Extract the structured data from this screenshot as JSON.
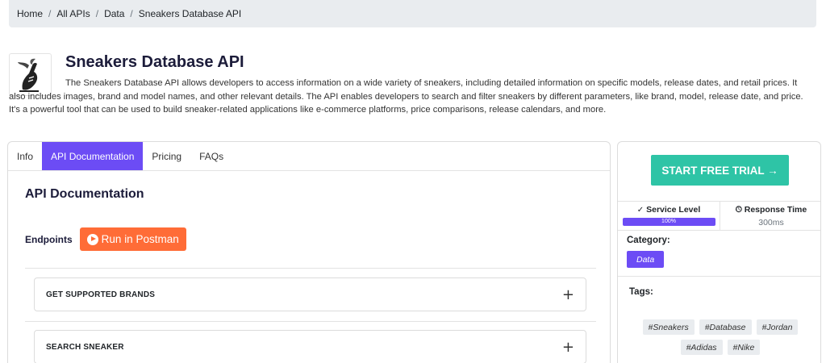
{
  "breadcrumb": [
    "Home",
    "All APIs",
    "Data",
    "Sneakers Database API"
  ],
  "api": {
    "title": "Sneakers Database API",
    "description": "The Sneakers Database API allows developers to access information on a wide variety of sneakers, including detailed information on specific models, release dates, and retail prices. It also includes images, brand and model names, and other relevant details. The API enables developers to search and filter sneakers by different parameters, like brand, model, release date, and price. It's a powerful tool that can be used to build sneaker-related applications like e-commerce platforms, price comparisons, release calendars, and more."
  },
  "tabs": [
    {
      "label": "Info",
      "active": false
    },
    {
      "label": "API Documentation",
      "active": true
    },
    {
      "label": "Pricing",
      "active": false
    },
    {
      "label": "FAQs",
      "active": false
    }
  ],
  "documentation": {
    "title": "API Documentation",
    "endpoints_label": "Endpoints",
    "postman_label": "Run in Postman",
    "endpoints": [
      {
        "name": "GET SUPPORTED BRANDS",
        "icon": "plus-icon"
      },
      {
        "name": "SEARCH SNEAKER",
        "icon": "plus-icon"
      }
    ]
  },
  "sidebar": {
    "trial_label": "START FREE TRIAL →",
    "service_level_label": "Service Level",
    "service_level_value": "100%",
    "service_level_fraction": 1.0,
    "response_time_label": "Response Time",
    "response_time_value": "300ms",
    "category_label": "Category:",
    "category_value": "Data",
    "tags_label": "Tags:",
    "tags": [
      "#Sneakers",
      "#Database",
      "#Jordan",
      "#Adidas",
      "#Nike"
    ]
  },
  "colors": {
    "accent": "#6c4cf5",
    "postman": "#ff6c37",
    "trial": "#2ec4a6"
  }
}
